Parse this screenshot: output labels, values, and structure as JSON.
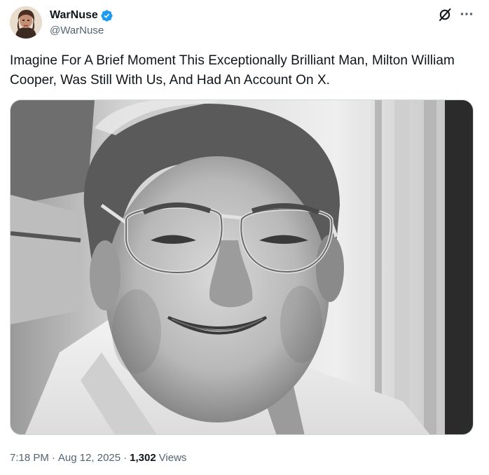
{
  "author": {
    "display_name": "WarNuse",
    "handle": "@WarNuse",
    "verified": true,
    "avatar": "profile-photo"
  },
  "header_icons": {
    "grok": "grok-slash-circle-icon",
    "more": "more-horizontal-icon"
  },
  "tweet": {
    "text": "Imagine For A Brief Moment This Exceptionally Brilliant Man, Milton William Cooper, Was Still With Us, And Had An Account On X.",
    "media": "black-and-white portrait photo"
  },
  "meta": {
    "time": "7:18 PM",
    "separator": "·",
    "date": "Aug 12, 2025",
    "views_count": "1,302",
    "views_label": "Views"
  },
  "colors": {
    "text_primary": "#0f1419",
    "text_secondary": "#536471",
    "verified_blue": "#1d9bf0",
    "border": "#cfd9de"
  }
}
